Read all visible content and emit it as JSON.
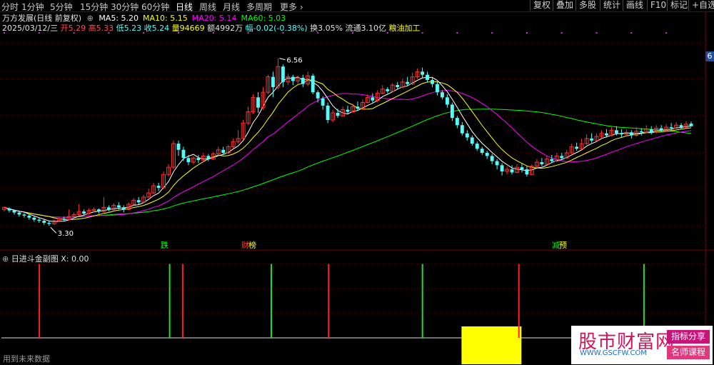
{
  "topbar": {
    "timeframes": [
      "分时",
      "1分钟",
      "5分钟",
      "15分钟",
      "30分钟",
      "60分钟",
      "日线",
      "周线",
      "月线",
      "多周期",
      "更多 ›"
    ],
    "active_index": 6,
    "buttons": [
      "复权",
      "叠加",
      "多股",
      "统计",
      "画线",
      "F10",
      "标记",
      "+自选"
    ]
  },
  "header": {
    "stock_name": "万方发展(日线 前复权)",
    "ma": [
      {
        "label": "MA5: 5.20",
        "color": "#ffffff"
      },
      {
        "label": "MA10: 5.15",
        "color": "#ffff00"
      },
      {
        "label": "MA20: 5.14",
        "color": "#ff00ff"
      },
      {
        "label": "MA60: 5.03",
        "color": "#00ff00"
      }
    ]
  },
  "quote": {
    "date": "2025/03/12/三",
    "open": "开5.29",
    "high": "高5.33",
    "low": "低5.23",
    "close": "收5.24",
    "volume": "量94669",
    "amount": "额4992万",
    "change": "幅-0.02(-0.38%)",
    "turnover": "换3.05%",
    "float": "流通3.10亿",
    "sector": "粮油加工"
  },
  "indicator_panel": {
    "title": "日进斗金副图",
    "x_value": "X: 0.00"
  },
  "signals": [
    {
      "label": "跌",
      "color": "#00ff00"
    },
    {
      "label": "财",
      "color": "#ff4040"
    },
    {
      "label": "榜",
      "color": "#ffff00"
    },
    {
      "label": "减",
      "color": "#00ff00"
    },
    {
      "label": "预",
      "color": "#ffff00"
    }
  ],
  "right_edge_label": "6",
  "watermark": {
    "main": "股市财富网",
    "url": "WWW.GSCFW.COM",
    "tag1": "指标分享",
    "tag2": "名师课程"
  },
  "footnote": "用到未来数据",
  "colors": {
    "up": "#ff3232",
    "down": "#54fcfc",
    "grid": "#7a0000",
    "ma5": "#ffffff",
    "ma10": "#ffff00",
    "ma20": "#ff00ff",
    "ma60": "#00ff00"
  },
  "chart_data": [
    {
      "type": "candlestick",
      "title": "",
      "ylim": [
        2.9,
        7.0
      ],
      "annotations": [
        {
          "label": "6.56",
          "value": 6.56,
          "candle_index": 55
        },
        {
          "label": "3.30",
          "value": 3.3,
          "candle_index": 9
        }
      ],
      "candles": [
        [
          3.62,
          3.66,
          3.58,
          3.68
        ],
        [
          3.64,
          3.6,
          3.56,
          3.66
        ],
        [
          3.6,
          3.56,
          3.52,
          3.62
        ],
        [
          3.56,
          3.52,
          3.48,
          3.58
        ],
        [
          3.52,
          3.5,
          3.46,
          3.55
        ],
        [
          3.5,
          3.46,
          3.42,
          3.52
        ],
        [
          3.46,
          3.42,
          3.38,
          3.48
        ],
        [
          3.42,
          3.4,
          3.36,
          3.46
        ],
        [
          3.4,
          3.36,
          3.32,
          3.42
        ],
        [
          3.36,
          3.34,
          3.3,
          3.4
        ],
        [
          3.34,
          3.4,
          3.32,
          3.42
        ],
        [
          3.4,
          3.44,
          3.38,
          3.46
        ],
        [
          3.44,
          3.42,
          3.4,
          3.48
        ],
        [
          3.42,
          3.48,
          3.4,
          3.62
        ],
        [
          3.48,
          3.52,
          3.46,
          3.56
        ],
        [
          3.52,
          3.58,
          3.5,
          3.72
        ],
        [
          3.58,
          3.54,
          3.5,
          3.62
        ],
        [
          3.54,
          3.6,
          3.52,
          3.64
        ],
        [
          3.6,
          3.62,
          3.56,
          3.66
        ],
        [
          3.62,
          3.58,
          3.54,
          3.64
        ],
        [
          3.58,
          3.66,
          3.56,
          3.86
        ],
        [
          3.66,
          3.62,
          3.58,
          3.7
        ],
        [
          3.62,
          3.7,
          3.6,
          3.74
        ],
        [
          3.7,
          3.66,
          3.62,
          3.76
        ],
        [
          3.66,
          3.62,
          3.56,
          3.7
        ],
        [
          3.62,
          3.72,
          3.6,
          3.76
        ],
        [
          3.72,
          3.8,
          3.7,
          3.84
        ],
        [
          3.8,
          3.76,
          3.72,
          3.86
        ],
        [
          3.76,
          3.86,
          3.74,
          3.9
        ],
        [
          3.86,
          3.94,
          3.84,
          4.02
        ],
        [
          3.94,
          4.08,
          3.92,
          4.14
        ],
        [
          4.08,
          4.04,
          3.98,
          4.14
        ],
        [
          4.04,
          4.3,
          4.02,
          4.36
        ],
        [
          4.3,
          4.44,
          4.26,
          4.5
        ],
        [
          4.44,
          4.9,
          4.4,
          4.96
        ],
        [
          4.9,
          4.78,
          4.66,
          4.96
        ],
        [
          4.78,
          4.62,
          4.56,
          4.84
        ],
        [
          4.62,
          4.54,
          4.48,
          4.68
        ],
        [
          4.54,
          4.62,
          4.5,
          4.66
        ],
        [
          4.62,
          4.58,
          4.52,
          4.68
        ],
        [
          4.58,
          4.66,
          4.54,
          4.72
        ],
        [
          4.66,
          4.6,
          4.56,
          4.7
        ],
        [
          4.6,
          4.7,
          4.58,
          4.74
        ],
        [
          4.7,
          4.78,
          4.66,
          4.84
        ],
        [
          4.78,
          4.72,
          4.68,
          4.84
        ],
        [
          4.72,
          4.84,
          4.7,
          4.88
        ],
        [
          4.84,
          4.94,
          4.8,
          5.0
        ],
        [
          4.94,
          5.0,
          4.9,
          5.16
        ],
        [
          5.0,
          5.3,
          4.98,
          5.36
        ],
        [
          5.3,
          5.52,
          5.26,
          5.62
        ],
        [
          5.52,
          5.8,
          5.48,
          5.86
        ],
        [
          5.8,
          5.6,
          5.5,
          5.9
        ],
        [
          5.6,
          5.9,
          5.56,
          6.0
        ],
        [
          5.9,
          6.2,
          5.86,
          6.24
        ],
        [
          6.2,
          6.0,
          5.8,
          6.3
        ],
        [
          6.0,
          6.4,
          5.96,
          6.56
        ],
        [
          6.4,
          6.1,
          6.0,
          6.44
        ],
        [
          6.1,
          6.2,
          6.04,
          6.26
        ],
        [
          6.2,
          6.12,
          6.04,
          6.24
        ],
        [
          6.12,
          6.18,
          6.06,
          6.22
        ],
        [
          6.18,
          6.06,
          6.0,
          6.24
        ],
        [
          6.06,
          6.22,
          6.02,
          6.3
        ],
        [
          6.22,
          5.9,
          5.86,
          6.26
        ],
        [
          5.9,
          5.78,
          5.7,
          5.94
        ],
        [
          5.78,
          5.64,
          5.56,
          5.82
        ],
        [
          5.64,
          5.36,
          5.3,
          5.7
        ],
        [
          5.36,
          5.5,
          5.32,
          5.56
        ],
        [
          5.5,
          5.44,
          5.4,
          5.58
        ],
        [
          5.44,
          5.56,
          5.42,
          5.62
        ],
        [
          5.56,
          5.52,
          5.48,
          5.64
        ],
        [
          5.52,
          5.62,
          5.5,
          5.68
        ],
        [
          5.62,
          5.58,
          5.54,
          5.72
        ],
        [
          5.58,
          5.7,
          5.56,
          5.76
        ],
        [
          5.7,
          5.8,
          5.68,
          5.86
        ],
        [
          5.8,
          5.74,
          5.7,
          5.88
        ],
        [
          5.74,
          5.88,
          5.7,
          5.94
        ],
        [
          5.88,
          5.96,
          5.86,
          6.04
        ],
        [
          5.96,
          5.92,
          5.88,
          6.0
        ],
        [
          5.92,
          6.04,
          5.9,
          6.08
        ],
        [
          6.04,
          6.0,
          5.96,
          6.1
        ],
        [
          6.0,
          6.1,
          5.98,
          6.16
        ],
        [
          6.1,
          6.06,
          6.02,
          6.2
        ],
        [
          6.06,
          6.2,
          6.04,
          6.28
        ],
        [
          6.2,
          6.3,
          6.16,
          6.36
        ],
        [
          6.3,
          6.24,
          6.18,
          6.38
        ],
        [
          6.24,
          6.14,
          6.1,
          6.3
        ],
        [
          6.14,
          6.06,
          6.0,
          6.2
        ],
        [
          6.06,
          5.9,
          5.84,
          6.1
        ],
        [
          5.9,
          5.8,
          5.76,
          5.94
        ],
        [
          5.8,
          5.66,
          5.6,
          5.86
        ],
        [
          5.66,
          5.4,
          5.34,
          5.7
        ],
        [
          5.4,
          5.26,
          5.2,
          5.44
        ],
        [
          5.26,
          5.1,
          5.06,
          5.32
        ],
        [
          5.1,
          5.02,
          4.96,
          5.16
        ],
        [
          5.02,
          4.9,
          4.86,
          5.06
        ],
        [
          4.9,
          4.8,
          4.76,
          4.94
        ],
        [
          4.8,
          4.72,
          4.68,
          4.84
        ],
        [
          4.72,
          4.66,
          4.6,
          4.76
        ],
        [
          4.66,
          4.56,
          4.5,
          4.7
        ],
        [
          4.56,
          4.48,
          4.4,
          4.6
        ],
        [
          4.48,
          4.36,
          4.28,
          4.52
        ],
        [
          4.36,
          4.4,
          4.3,
          4.46
        ],
        [
          4.4,
          4.34,
          4.3,
          4.48
        ],
        [
          4.34,
          4.44,
          4.32,
          4.5
        ],
        [
          4.44,
          4.4,
          4.34,
          4.52
        ],
        [
          4.4,
          4.3,
          4.26,
          4.46
        ],
        [
          4.3,
          4.46,
          4.28,
          4.5
        ],
        [
          4.46,
          4.54,
          4.44,
          4.6
        ],
        [
          4.54,
          4.5,
          4.46,
          4.62
        ],
        [
          4.5,
          4.6,
          4.48,
          4.66
        ],
        [
          4.6,
          4.56,
          4.52,
          4.68
        ],
        [
          4.56,
          4.66,
          4.54,
          4.72
        ],
        [
          4.66,
          4.62,
          4.58,
          4.72
        ],
        [
          4.62,
          4.72,
          4.6,
          4.78
        ],
        [
          4.72,
          4.84,
          4.7,
          4.9
        ],
        [
          4.84,
          4.8,
          4.76,
          4.92
        ],
        [
          4.8,
          4.9,
          4.78,
          5.0
        ],
        [
          4.9,
          5.0,
          4.88,
          5.08
        ],
        [
          5.0,
          4.96,
          4.92,
          5.1
        ],
        [
          4.96,
          5.04,
          4.94,
          5.1
        ],
        [
          5.04,
          5.1,
          5.0,
          5.16
        ],
        [
          5.1,
          5.06,
          5.02,
          5.18
        ],
        [
          5.06,
          5.16,
          5.04,
          5.22
        ],
        [
          5.16,
          5.1,
          5.06,
          5.24
        ],
        [
          5.1,
          5.08,
          5.02,
          5.18
        ],
        [
          5.08,
          5.12,
          5.04,
          5.18
        ],
        [
          5.12,
          5.06,
          5.0,
          5.16
        ],
        [
          5.06,
          5.14,
          5.04,
          5.22
        ],
        [
          5.14,
          5.12,
          5.06,
          5.2
        ],
        [
          5.12,
          5.18,
          5.1,
          5.26
        ],
        [
          5.18,
          5.12,
          5.08,
          5.24
        ],
        [
          5.12,
          5.2,
          5.1,
          5.26
        ],
        [
          5.2,
          5.16,
          5.12,
          5.26
        ],
        [
          5.16,
          5.22,
          5.14,
          5.28
        ],
        [
          5.22,
          5.2,
          5.16,
          5.3
        ],
        [
          5.2,
          5.26,
          5.18,
          5.32
        ],
        [
          5.26,
          5.22,
          5.18,
          5.3
        ],
        [
          5.22,
          5.28,
          5.2,
          5.34
        ],
        [
          5.29,
          5.24,
          5.23,
          5.33
        ]
      ]
    },
    {
      "type": "bar",
      "title": "日进斗金副图",
      "bars": [
        {
          "x_index": 14,
          "value": 0.9,
          "color": "red"
        },
        {
          "x_index": 64,
          "value": 0.9,
          "color": "green"
        },
        {
          "x_index": 69,
          "value": 0.9,
          "color": "red"
        },
        {
          "x_index": 103,
          "value": 0.9,
          "color": "green"
        },
        {
          "x_index": 125,
          "value": 0.9,
          "color": "red"
        },
        {
          "x_index": 161,
          "value": 0.9,
          "color": "green"
        },
        {
          "x_index": 198,
          "value": 0.9,
          "color": "red"
        },
        {
          "x_index": 246,
          "value": 0.9,
          "color": "green"
        }
      ],
      "blocks": [
        {
          "x_start_index": 176,
          "x_end_index": 199,
          "value": 0.4,
          "color": "yellow"
        }
      ]
    }
  ]
}
